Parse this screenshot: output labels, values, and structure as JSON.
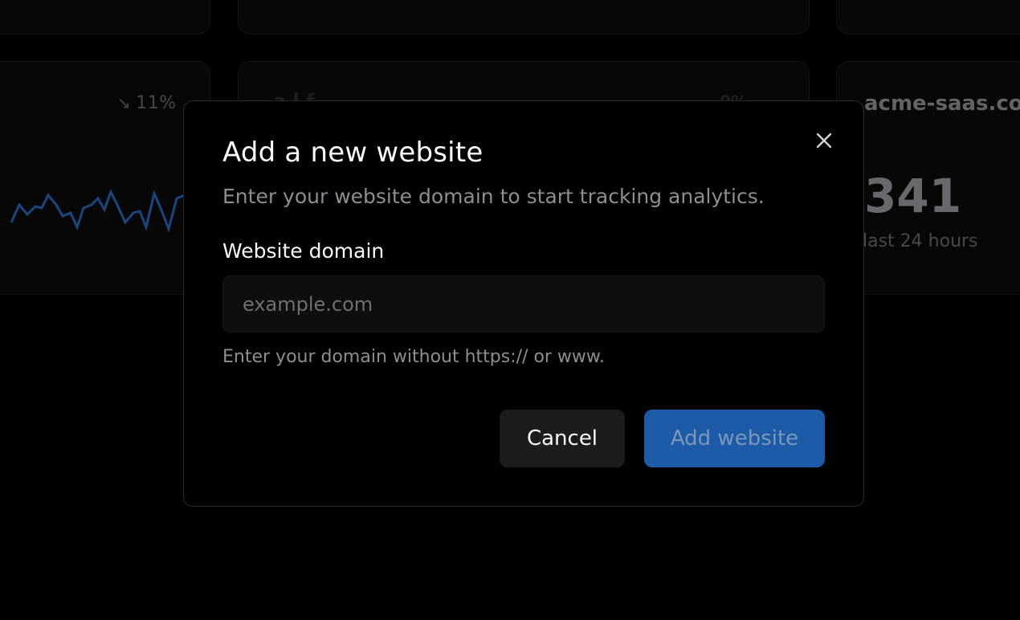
{
  "background": {
    "card1": {
      "trend_value": "11%",
      "trend_direction": "down",
      "sparkline_color": "#2a6bc2"
    },
    "card2": {
      "title_partial": "a   l   f",
      "trend_value": "0%"
    },
    "card3": {
      "domain": "acme-saas.co",
      "visitors": "341",
      "period": "last 24 hours"
    }
  },
  "modal": {
    "title": "Add a new website",
    "description": "Enter your website domain to start tracking analytics.",
    "field_label": "Website domain",
    "field_value": "",
    "field_placeholder": "example.com",
    "field_hint": "Enter your domain without https:// or www.",
    "cancel_label": "Cancel",
    "submit_label": "Add website",
    "close_icon": "close-icon"
  },
  "colors": {
    "primary": "#1d5ba8",
    "background": "#000000",
    "card": "#0b0b0d"
  }
}
